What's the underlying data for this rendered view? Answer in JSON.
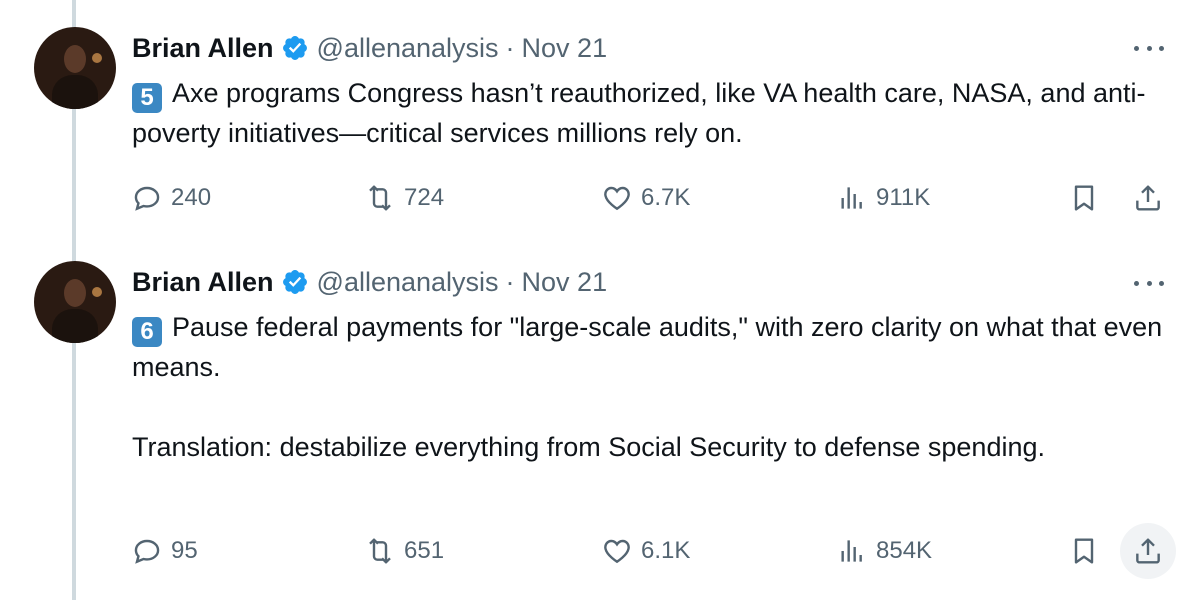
{
  "tweets": [
    {
      "author": "Brian Allen",
      "handle": "@allenanalysis",
      "separator": "·",
      "date": "Nov 21",
      "keycap": "5",
      "paragraphs": [
        "Axe programs Congress hasn’t reauthorized, like VA health care, NASA, and anti-poverty initiatives—critical services millions rely on."
      ],
      "stats": {
        "replies": "240",
        "reposts": "724",
        "likes": "6.7K",
        "views": "911K"
      }
    },
    {
      "author": "Brian Allen",
      "handle": "@allenanalysis",
      "separator": "·",
      "date": "Nov 21",
      "keycap": "6",
      "paragraphs": [
        "Pause federal payments for \"large-scale audits,\" with zero clarity on what that even means.",
        "Translation: destabilize everything from Social Security to defense spending."
      ],
      "stats": {
        "replies": "95",
        "reposts": "651",
        "likes": "6.1K",
        "views": "854K"
      }
    }
  ],
  "icons": {
    "verified": "verified-badge-icon",
    "more": "more-icon",
    "reply": "reply-icon",
    "repost": "repost-icon",
    "like": "heart-icon",
    "views": "views-icon",
    "bookmark": "bookmark-icon",
    "share": "share-icon"
  },
  "colors": {
    "text": "#0f1419",
    "secondary": "#536471",
    "verified": "#1d9bf0",
    "keycap": "#3b88c3",
    "thread_line": "#cfd9de"
  }
}
